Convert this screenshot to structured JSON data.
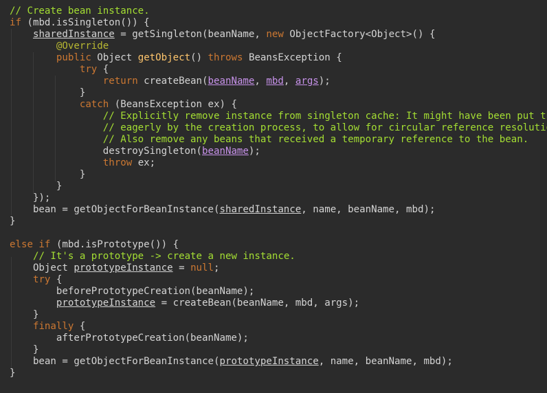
{
  "editor": {
    "colors": {
      "background": "#2b2b2b",
      "comment": "#a4de33",
      "keyword": "#cc7832",
      "text": "#d4d4d4",
      "annotation": "#b8b832",
      "method": "#ffc66d",
      "param_underline": "#c792ea"
    },
    "lines": [
      [
        {
          "t": "c",
          "v": "// Create bean instance."
        }
      ],
      [
        {
          "t": "k",
          "v": "if"
        },
        {
          "t": "t",
          "v": " (mbd.isSingleton()) {"
        }
      ],
      [
        {
          "t": "t",
          "v": "    "
        },
        {
          "t": "u",
          "v": "sharedInstance"
        },
        {
          "t": "t",
          "v": " = getSingleton(beanName, "
        },
        {
          "t": "k",
          "v": "new"
        },
        {
          "t": "t",
          "v": " ObjectFactory<Object>() {"
        }
      ],
      [
        {
          "t": "t",
          "v": "        "
        },
        {
          "t": "a",
          "v": "@Override"
        }
      ],
      [
        {
          "t": "t",
          "v": "        "
        },
        {
          "t": "k",
          "v": "public"
        },
        {
          "t": "t",
          "v": " Object "
        },
        {
          "t": "m",
          "v": "getObject"
        },
        {
          "t": "t",
          "v": "() "
        },
        {
          "t": "k",
          "v": "throws"
        },
        {
          "t": "t",
          "v": " BeansException {"
        }
      ],
      [
        {
          "t": "t",
          "v": "            "
        },
        {
          "t": "k",
          "v": "try"
        },
        {
          "t": "t",
          "v": " {"
        }
      ],
      [
        {
          "t": "t",
          "v": "                "
        },
        {
          "t": "k",
          "v": "return"
        },
        {
          "t": "t",
          "v": " createBean("
        },
        {
          "t": "pl",
          "v": "beanName"
        },
        {
          "t": "t",
          "v": ", "
        },
        {
          "t": "pl",
          "v": "mbd"
        },
        {
          "t": "t",
          "v": ", "
        },
        {
          "t": "pl",
          "v": "args"
        },
        {
          "t": "t",
          "v": ");"
        }
      ],
      [
        {
          "t": "t",
          "v": "            }"
        }
      ],
      [
        {
          "t": "t",
          "v": "            "
        },
        {
          "t": "k",
          "v": "catch"
        },
        {
          "t": "t",
          "v": " (BeansException ex) {"
        }
      ],
      [
        {
          "t": "t",
          "v": "                "
        },
        {
          "t": "c",
          "v": "// Explicitly remove instance from singleton cache: It might have been put there"
        }
      ],
      [
        {
          "t": "t",
          "v": "                "
        },
        {
          "t": "c",
          "v": "// eagerly by the creation process, to allow for circular reference resolution."
        }
      ],
      [
        {
          "t": "t",
          "v": "                "
        },
        {
          "t": "c",
          "v": "// Also remove any beans that received a temporary reference to the bean."
        }
      ],
      [
        {
          "t": "t",
          "v": "                destroySingleton("
        },
        {
          "t": "pl",
          "v": "beanName"
        },
        {
          "t": "t",
          "v": ");"
        }
      ],
      [
        {
          "t": "t",
          "v": "                "
        },
        {
          "t": "k",
          "v": "throw"
        },
        {
          "t": "t",
          "v": " ex;"
        }
      ],
      [
        {
          "t": "t",
          "v": "            }"
        }
      ],
      [
        {
          "t": "t",
          "v": "        }"
        }
      ],
      [
        {
          "t": "t",
          "v": "    });"
        }
      ],
      [
        {
          "t": "t",
          "v": "    bean = getObjectForBeanInstance("
        },
        {
          "t": "u",
          "v": "sharedInstance"
        },
        {
          "t": "t",
          "v": ", name, beanName, mbd);"
        }
      ],
      [
        {
          "t": "t",
          "v": "}"
        }
      ],
      [
        {
          "t": "t",
          "v": ""
        }
      ],
      [
        {
          "t": "k",
          "v": "else if"
        },
        {
          "t": "t",
          "v": " (mbd.isPrototype()) {"
        }
      ],
      [
        {
          "t": "t",
          "v": "    "
        },
        {
          "t": "c",
          "v": "// It's a prototype -> create a new instance."
        }
      ],
      [
        {
          "t": "t",
          "v": "    Object "
        },
        {
          "t": "u",
          "v": "prototypeInstance"
        },
        {
          "t": "t",
          "v": " = "
        },
        {
          "t": "n",
          "v": "null"
        },
        {
          "t": "t",
          "v": ";"
        }
      ],
      [
        {
          "t": "t",
          "v": "    "
        },
        {
          "t": "k",
          "v": "try"
        },
        {
          "t": "t",
          "v": " {"
        }
      ],
      [
        {
          "t": "t",
          "v": "        beforePrototypeCreation(beanName);"
        }
      ],
      [
        {
          "t": "t",
          "v": "        "
        },
        {
          "t": "u",
          "v": "prototypeInstance"
        },
        {
          "t": "t",
          "v": " = createBean(beanName, mbd, args);"
        }
      ],
      [
        {
          "t": "t",
          "v": "    }"
        }
      ],
      [
        {
          "t": "t",
          "v": "    "
        },
        {
          "t": "k",
          "v": "finally"
        },
        {
          "t": "t",
          "v": " {"
        }
      ],
      [
        {
          "t": "t",
          "v": "        afterPrototypeCreation(beanName);"
        }
      ],
      [
        {
          "t": "t",
          "v": "    }"
        }
      ],
      [
        {
          "t": "t",
          "v": "    bean = getObjectForBeanInstance("
        },
        {
          "t": "u",
          "v": "prototypeInstance"
        },
        {
          "t": "t",
          "v": ", name, beanName, mbd);"
        }
      ],
      [
        {
          "t": "t",
          "v": "}"
        }
      ]
    ]
  }
}
